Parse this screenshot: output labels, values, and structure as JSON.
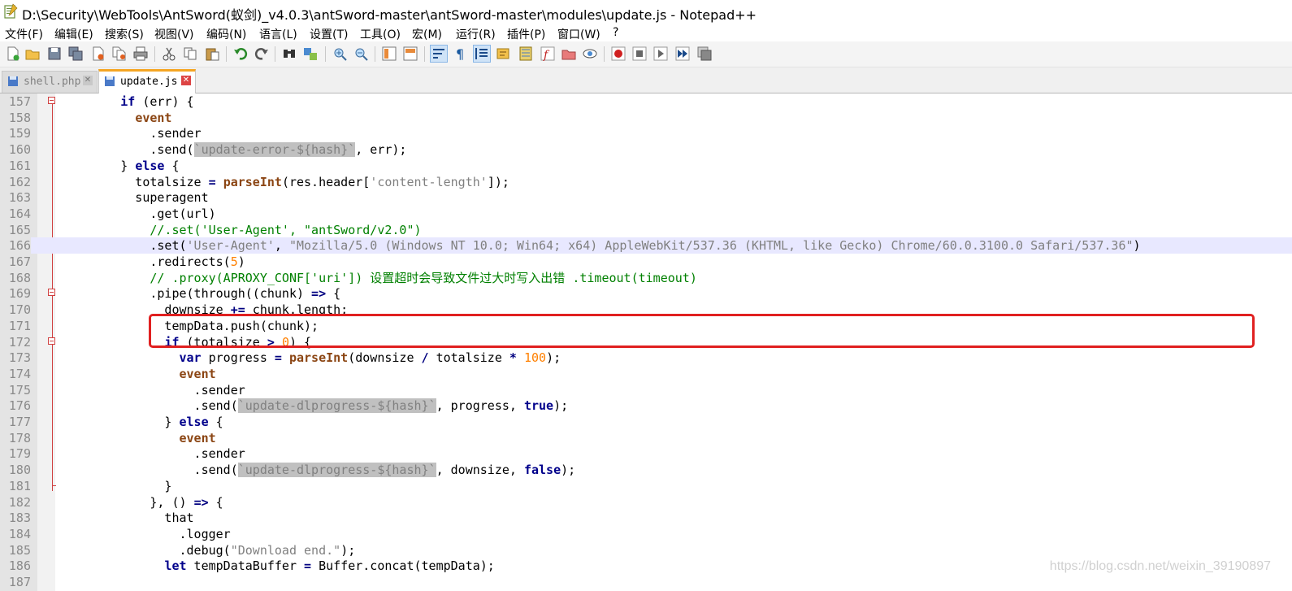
{
  "window": {
    "title": "D:\\Security\\WebTools\\AntSword(蚁剑)_v4.0.3\\antSword-master\\antSword-master\\modules\\update.js - Notepad++"
  },
  "menu": [
    "文件(F)",
    "编辑(E)",
    "搜索(S)",
    "视图(V)",
    "编码(N)",
    "语言(L)",
    "设置(T)",
    "工具(O)",
    "宏(M)",
    "运行(R)",
    "插件(P)",
    "窗口(W)",
    "?"
  ],
  "tabs": [
    {
      "label": "shell.php",
      "active": false,
      "icon": "save-disk-icon"
    },
    {
      "label": "update.js",
      "active": true,
      "icon": "save-disk-icon"
    }
  ],
  "editor": {
    "current_line": 166,
    "lines": [
      {
        "n": "157",
        "t": [
          [
            "        ",
            ""
          ],
          [
            "if",
            "kw"
          ],
          [
            " (err) {",
            "txt"
          ]
        ]
      },
      {
        "n": "158",
        "t": [
          [
            "          ",
            ""
          ],
          [
            "event",
            "kwb"
          ]
        ]
      },
      {
        "n": "159",
        "t": [
          [
            "            .sender",
            "txt"
          ]
        ]
      },
      {
        "n": "160",
        "t": [
          [
            "            .send(",
            "txt"
          ],
          [
            "`update-error-${hash}`",
            "tpl"
          ],
          [
            ", err);",
            "txt"
          ]
        ]
      },
      {
        "n": "161",
        "t": [
          [
            "        } ",
            "txt"
          ],
          [
            "else",
            "kw"
          ],
          [
            " {",
            "txt"
          ]
        ]
      },
      {
        "n": "162",
        "t": [
          [
            "          totalsize ",
            "txt"
          ],
          [
            "=",
            "op"
          ],
          [
            " ",
            "txt"
          ],
          [
            "parseInt",
            "fn"
          ],
          [
            "(res.header[",
            "txt"
          ],
          [
            "'content-length'",
            "str"
          ],
          [
            "]);",
            "txt"
          ]
        ]
      },
      {
        "n": "163",
        "t": [
          [
            "          superagent",
            "txt"
          ]
        ]
      },
      {
        "n": "164",
        "t": [
          [
            "            .get(url)",
            "txt"
          ]
        ]
      },
      {
        "n": "165",
        "t": [
          [
            "            ",
            ""
          ],
          [
            "//.set('User-Agent', \"antSword/v2.0\")",
            "com"
          ]
        ]
      },
      {
        "n": "166",
        "t": [
          [
            "            .set(",
            "txt"
          ],
          [
            "'User-Agent'",
            "str"
          ],
          [
            ", ",
            "txt"
          ],
          [
            "\"Mozilla/5.0 (Windows NT 10.0; Win64; x64) AppleWebKit/537.36 (KHTML, like Gecko) Chrome/60.0.3100.0 Safari/537.36\"",
            "str"
          ],
          [
            ")",
            "txt"
          ]
        ]
      },
      {
        "n": "167",
        "t": [
          [
            "            .redirects(",
            "txt"
          ],
          [
            "5",
            "num"
          ],
          [
            ")",
            "txt"
          ]
        ]
      },
      {
        "n": "168",
        "t": [
          [
            "            ",
            ""
          ],
          [
            "// .proxy(APROXY_CONF['uri']) 设置超时会导致文件过大时写入出错 .timeout(timeout)",
            "com"
          ]
        ]
      },
      {
        "n": "169",
        "t": [
          [
            "            .pipe(through((chunk) ",
            "txt"
          ],
          [
            "=>",
            "op"
          ],
          [
            " {",
            "txt"
          ]
        ]
      },
      {
        "n": "170",
        "t": [
          [
            "              downsize ",
            "txt"
          ],
          [
            "+=",
            "op"
          ],
          [
            " chunk.length;",
            "txt"
          ]
        ]
      },
      {
        "n": "171",
        "t": [
          [
            "              tempData.push(chunk);",
            "txt"
          ]
        ]
      },
      {
        "n": "172",
        "t": [
          [
            "              ",
            ""
          ],
          [
            "if",
            "kw"
          ],
          [
            " (totalsize ",
            "txt"
          ],
          [
            ">",
            "op"
          ],
          [
            " ",
            "txt"
          ],
          [
            "0",
            "num"
          ],
          [
            ") {",
            "txt"
          ]
        ]
      },
      {
        "n": "173",
        "t": [
          [
            "                ",
            ""
          ],
          [
            "var",
            "kw"
          ],
          [
            " progress ",
            "txt"
          ],
          [
            "=",
            "op"
          ],
          [
            " ",
            "txt"
          ],
          [
            "parseInt",
            "fn"
          ],
          [
            "(downsize ",
            "txt"
          ],
          [
            "/",
            "op"
          ],
          [
            " totalsize ",
            "txt"
          ],
          [
            "*",
            "op"
          ],
          [
            " ",
            "txt"
          ],
          [
            "100",
            "num"
          ],
          [
            ");",
            "txt"
          ]
        ]
      },
      {
        "n": "174",
        "t": [
          [
            "                ",
            ""
          ],
          [
            "event",
            "kwb"
          ]
        ]
      },
      {
        "n": "175",
        "t": [
          [
            "                  .sender",
            "txt"
          ]
        ]
      },
      {
        "n": "176",
        "t": [
          [
            "                  .send(",
            "txt"
          ],
          [
            "`update-dlprogress-${hash}`",
            "tpl"
          ],
          [
            ", progress, ",
            "txt"
          ],
          [
            "true",
            "kw"
          ],
          [
            ");",
            "txt"
          ]
        ]
      },
      {
        "n": "177",
        "t": [
          [
            "              } ",
            "txt"
          ],
          [
            "else",
            "kw"
          ],
          [
            " {",
            "txt"
          ]
        ]
      },
      {
        "n": "178",
        "t": [
          [
            "                ",
            ""
          ],
          [
            "event",
            "kwb"
          ]
        ]
      },
      {
        "n": "179",
        "t": [
          [
            "                  .sender",
            "txt"
          ]
        ]
      },
      {
        "n": "180",
        "t": [
          [
            "                  .send(",
            "txt"
          ],
          [
            "`update-dlprogress-${hash}`",
            "tpl"
          ],
          [
            ", downsize, ",
            "txt"
          ],
          [
            "false",
            "kw"
          ],
          [
            ");",
            "txt"
          ]
        ]
      },
      {
        "n": "181",
        "t": [
          [
            "              }",
            "txt"
          ]
        ]
      },
      {
        "n": "182",
        "t": [
          [
            "            }, () ",
            "txt"
          ],
          [
            "=>",
            "op"
          ],
          [
            " {",
            "txt"
          ]
        ]
      },
      {
        "n": "183",
        "t": [
          [
            "              that",
            "txt"
          ]
        ]
      },
      {
        "n": "184",
        "t": [
          [
            "                .logger",
            "txt"
          ]
        ]
      },
      {
        "n": "185",
        "t": [
          [
            "                .debug(",
            "txt"
          ],
          [
            "\"Download end.\"",
            "str"
          ],
          [
            ");",
            "txt"
          ]
        ]
      },
      {
        "n": "186",
        "t": [
          [
            "              ",
            ""
          ],
          [
            "let",
            "kw"
          ],
          [
            " tempDataBuffer ",
            "txt"
          ],
          [
            "=",
            "op"
          ],
          [
            " Buffer.concat(tempData);",
            "txt"
          ]
        ]
      },
      {
        "n": "187",
        "t": [
          [
            "",
            "txt"
          ]
        ]
      }
    ]
  },
  "watermark": "https://blog.csdn.net/weixin_39190897"
}
